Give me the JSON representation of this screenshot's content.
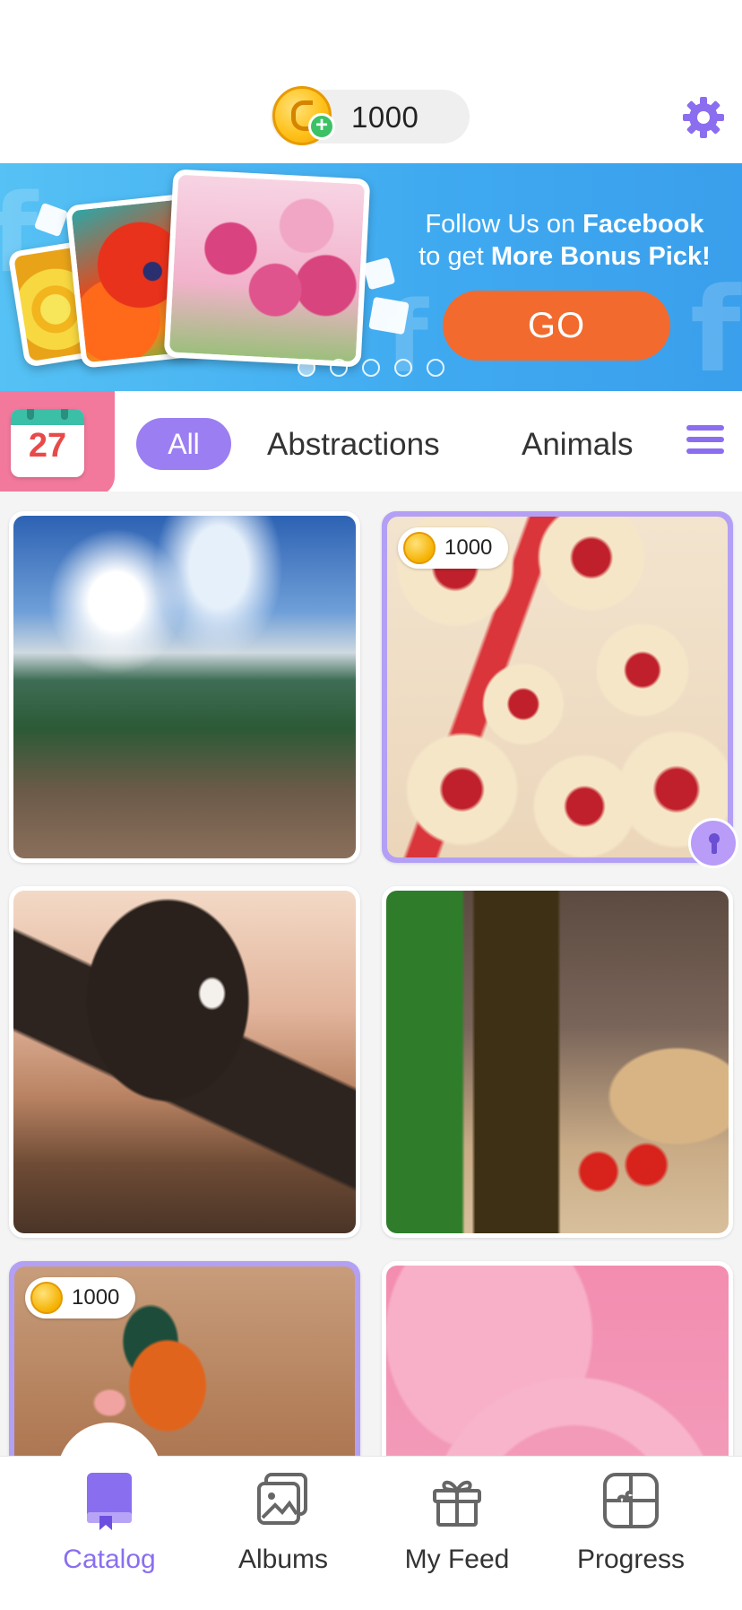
{
  "header": {
    "coin_balance": "1000",
    "icons": {
      "coin": "coin-icon",
      "add": "plus-icon",
      "settings": "gear-icon"
    }
  },
  "banner": {
    "line1_prefix": "Follow Us on ",
    "line1_bold": "Facebook",
    "line2_prefix": "to get ",
    "line2_bold": "More Bonus Pick!",
    "go_label": "GO",
    "carousel": {
      "count": 5,
      "active_index": 0
    },
    "colors": {
      "background": "#3fa9f0",
      "go_button": "#f26a2e"
    }
  },
  "category_bar": {
    "calendar_day": "27",
    "categories": [
      {
        "label": "All",
        "selected": true
      },
      {
        "label": "Abstractions",
        "selected": false
      },
      {
        "label": "Animals",
        "selected": false
      }
    ],
    "colors": {
      "accent": "#9b7ef2",
      "calendar_tab": "#f2789c"
    },
    "icons": {
      "calendar": "calendar-icon",
      "menu": "menu-icon"
    }
  },
  "grid": {
    "tiles": [
      {
        "subject": "mountain trail",
        "locked": false,
        "price": null
      },
      {
        "subject": "jam cookies",
        "locked": true,
        "price": "1000"
      },
      {
        "subject": "eagle",
        "locked": false,
        "price": null
      },
      {
        "subject": "olive oil and tomatoes",
        "locked": false,
        "price": null
      },
      {
        "subject": "mandarin duck",
        "locked": true,
        "price": "1000"
      },
      {
        "subject": "pink rose",
        "locked": false,
        "price": null
      }
    ]
  },
  "bottom_nav": {
    "items": [
      {
        "label": "Catalog",
        "icon": "book-icon",
        "active": true
      },
      {
        "label": "Albums",
        "icon": "photo-album-icon",
        "active": false
      },
      {
        "label": "My Feed",
        "icon": "gift-icon",
        "active": false
      },
      {
        "label": "Progress",
        "icon": "puzzle-icon",
        "active": false
      }
    ],
    "colors": {
      "active": "#8a6ef0",
      "inactive": "#333333"
    }
  }
}
